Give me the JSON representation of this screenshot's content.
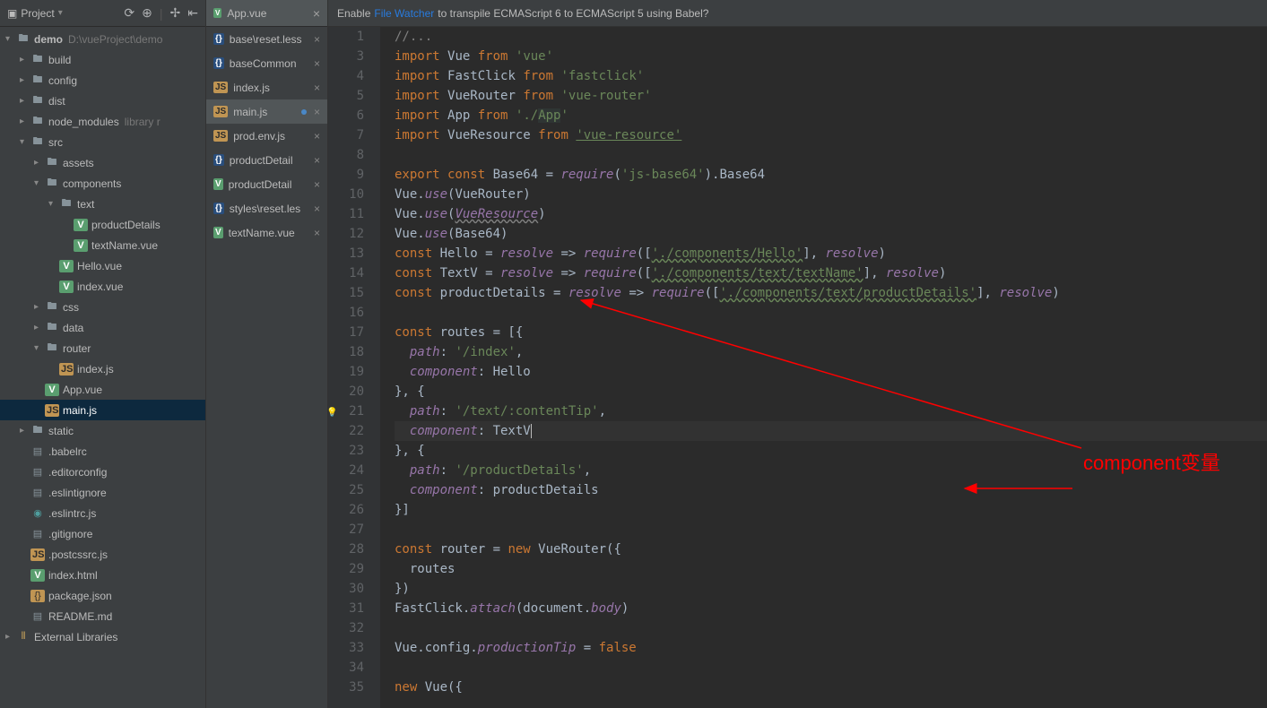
{
  "project": {
    "panel_title": "Project",
    "toolbar_icons": [
      "refresh-icon",
      "target-icon",
      "divider",
      "settings-icon",
      "collapse-icon"
    ],
    "tree": [
      {
        "depth": 0,
        "arrow": "▾",
        "icon": "folder",
        "label": "demo",
        "extra": "D:\\vueProject\\demo",
        "bold": true
      },
      {
        "depth": 1,
        "arrow": "▸",
        "icon": "folder",
        "label": "build"
      },
      {
        "depth": 1,
        "arrow": "▸",
        "icon": "folder",
        "label": "config"
      },
      {
        "depth": 1,
        "arrow": "▸",
        "icon": "folder",
        "label": "dist"
      },
      {
        "depth": 1,
        "arrow": "▸",
        "icon": "folder",
        "label": "node_modules",
        "extra": "library r"
      },
      {
        "depth": 1,
        "arrow": "▾",
        "icon": "folder",
        "label": "src"
      },
      {
        "depth": 2,
        "arrow": "▸",
        "icon": "folder",
        "label": "assets"
      },
      {
        "depth": 2,
        "arrow": "▾",
        "icon": "folder",
        "label": "components"
      },
      {
        "depth": 3,
        "arrow": "▾",
        "icon": "folder",
        "label": "text"
      },
      {
        "depth": 4,
        "arrow": "",
        "icon": "vue",
        "label": "productDetails"
      },
      {
        "depth": 4,
        "arrow": "",
        "icon": "vue",
        "label": "textName.vue"
      },
      {
        "depth": 3,
        "arrow": "",
        "icon": "vue",
        "label": "Hello.vue"
      },
      {
        "depth": 3,
        "arrow": "",
        "icon": "vue",
        "label": "index.vue"
      },
      {
        "depth": 2,
        "arrow": "▸",
        "icon": "folder",
        "label": "css"
      },
      {
        "depth": 2,
        "arrow": "▸",
        "icon": "folder",
        "label": "data"
      },
      {
        "depth": 2,
        "arrow": "▾",
        "icon": "folder",
        "label": "router"
      },
      {
        "depth": 3,
        "arrow": "",
        "icon": "js",
        "label": "index.js"
      },
      {
        "depth": 2,
        "arrow": "",
        "icon": "vue",
        "label": "App.vue"
      },
      {
        "depth": 2,
        "arrow": "",
        "icon": "js",
        "label": "main.js",
        "selected": true
      },
      {
        "depth": 1,
        "arrow": "▸",
        "icon": "folder",
        "label": "static"
      },
      {
        "depth": 1,
        "arrow": "",
        "icon": "file",
        "label": ".babelrc"
      },
      {
        "depth": 1,
        "arrow": "",
        "icon": "file",
        "label": ".editorconfig"
      },
      {
        "depth": 1,
        "arrow": "",
        "icon": "file",
        "label": ".eslintignore"
      },
      {
        "depth": 1,
        "arrow": "",
        "icon": "teal",
        "label": ".eslintrc.js"
      },
      {
        "depth": 1,
        "arrow": "",
        "icon": "file",
        "label": ".gitignore"
      },
      {
        "depth": 1,
        "arrow": "",
        "icon": "js",
        "label": ".postcssrc.js"
      },
      {
        "depth": 1,
        "arrow": "",
        "icon": "vue",
        "label": "index.html"
      },
      {
        "depth": 1,
        "arrow": "",
        "icon": "json",
        "label": "package.json"
      },
      {
        "depth": 1,
        "arrow": "",
        "icon": "file",
        "label": "README.md"
      },
      {
        "depth": 0,
        "arrow": "▸",
        "icon": "lib",
        "label": "External Libraries"
      }
    ]
  },
  "tabs": {
    "top": {
      "icon": "vue",
      "label": "App.vue"
    },
    "items": [
      {
        "icon": "less",
        "label": "base\\reset.less"
      },
      {
        "icon": "less",
        "label": "baseCommon"
      },
      {
        "icon": "js",
        "label": "index.js"
      },
      {
        "icon": "js",
        "label": "main.js",
        "active": true,
        "modified": true
      },
      {
        "icon": "js",
        "label": "prod.env.js"
      },
      {
        "icon": "less",
        "label": "productDetail"
      },
      {
        "icon": "vue",
        "label": "productDetail"
      },
      {
        "icon": "less",
        "label": "styles\\reset.les"
      },
      {
        "icon": "vue",
        "label": "textName.vue"
      }
    ]
  },
  "notification": {
    "prefix": "Enable",
    "link": "File Watcher",
    "suffix": "to transpile ECMAScript 6 to ECMAScript 5 using Babel?"
  },
  "editor": {
    "lines": [
      {
        "n": 1,
        "tokens": [
          {
            "t": "//...",
            "c": "comment"
          }
        ]
      },
      {
        "n": 3,
        "tokens": [
          {
            "t": "import ",
            "c": "kw"
          },
          {
            "t": "Vue ",
            "c": "id"
          },
          {
            "t": "from ",
            "c": "kw"
          },
          {
            "t": "'vue'",
            "c": "str"
          }
        ]
      },
      {
        "n": 4,
        "tokens": [
          {
            "t": "import ",
            "c": "kw"
          },
          {
            "t": "FastClick ",
            "c": "id"
          },
          {
            "t": "from ",
            "c": "kw"
          },
          {
            "t": "'fastclick'",
            "c": "str"
          }
        ]
      },
      {
        "n": 5,
        "tokens": [
          {
            "t": "import ",
            "c": "kw"
          },
          {
            "t": "VueRouter ",
            "c": "id"
          },
          {
            "t": "from ",
            "c": "kw"
          },
          {
            "t": "'vue-router'",
            "c": "str"
          }
        ]
      },
      {
        "n": 6,
        "tokens": [
          {
            "t": "import ",
            "c": "kw"
          },
          {
            "t": "App ",
            "c": "id"
          },
          {
            "t": "from ",
            "c": "kw"
          },
          {
            "t": "'./",
            "c": "str"
          },
          {
            "t": "App",
            "c": "str bg-hint"
          },
          {
            "t": "'",
            "c": "str"
          }
        ]
      },
      {
        "n": 7,
        "tokens": [
          {
            "t": "import ",
            "c": "kw"
          },
          {
            "t": "VueResource ",
            "c": "id"
          },
          {
            "t": "from ",
            "c": "kw"
          },
          {
            "t": "'vue-resource'",
            "c": "link-str underline-green"
          }
        ]
      },
      {
        "n": 8,
        "tokens": []
      },
      {
        "n": 9,
        "tokens": [
          {
            "t": "export const ",
            "c": "kw"
          },
          {
            "t": "Base64 = ",
            "c": "id"
          },
          {
            "t": "require",
            "c": "var"
          },
          {
            "t": "(",
            "c": "id"
          },
          {
            "t": "'js-base64'",
            "c": "str"
          },
          {
            "t": ").Base64",
            "c": "id"
          }
        ]
      },
      {
        "n": 10,
        "tokens": [
          {
            "t": "Vue.",
            "c": "id"
          },
          {
            "t": "use",
            "c": "var"
          },
          {
            "t": "(VueRouter)",
            "c": "id"
          }
        ]
      },
      {
        "n": 11,
        "tokens": [
          {
            "t": "Vue.",
            "c": "id"
          },
          {
            "t": "use",
            "c": "var"
          },
          {
            "t": "(",
            "c": "id"
          },
          {
            "t": "VueResource",
            "c": "var underline-gray"
          },
          {
            "t": ")",
            "c": "id"
          }
        ]
      },
      {
        "n": 12,
        "tokens": [
          {
            "t": "Vue.",
            "c": "id"
          },
          {
            "t": "use",
            "c": "var"
          },
          {
            "t": "(Base64)",
            "c": "id"
          }
        ]
      },
      {
        "n": 13,
        "tokens": [
          {
            "t": "const ",
            "c": "kw"
          },
          {
            "t": "Hello = ",
            "c": "id"
          },
          {
            "t": "resolve",
            "c": "var"
          },
          {
            "t": " => ",
            "c": "id"
          },
          {
            "t": "require",
            "c": "var"
          },
          {
            "t": "([",
            "c": "id"
          },
          {
            "t": "'./components/Hello'",
            "c": "str underline-green"
          },
          {
            "t": "], ",
            "c": "id"
          },
          {
            "t": "resolve",
            "c": "var"
          },
          {
            "t": ")",
            "c": "id"
          }
        ]
      },
      {
        "n": 14,
        "tokens": [
          {
            "t": "const ",
            "c": "kw"
          },
          {
            "t": "TextV = ",
            "c": "id"
          },
          {
            "t": "resolve",
            "c": "var"
          },
          {
            "t": " => ",
            "c": "id"
          },
          {
            "t": "require",
            "c": "var"
          },
          {
            "t": "([",
            "c": "id"
          },
          {
            "t": "'./components/text/textName'",
            "c": "str underline-green"
          },
          {
            "t": "], ",
            "c": "id"
          },
          {
            "t": "resolve",
            "c": "var"
          },
          {
            "t": ")",
            "c": "id"
          }
        ]
      },
      {
        "n": 15,
        "tokens": [
          {
            "t": "const ",
            "c": "kw"
          },
          {
            "t": "productDetails = ",
            "c": "id"
          },
          {
            "t": "resolve",
            "c": "var"
          },
          {
            "t": " => ",
            "c": "id"
          },
          {
            "t": "require",
            "c": "var"
          },
          {
            "t": "([",
            "c": "id"
          },
          {
            "t": "'./components/text/productDetails'",
            "c": "str underline-green"
          },
          {
            "t": "], ",
            "c": "id"
          },
          {
            "t": "resolve",
            "c": "var"
          },
          {
            "t": ")",
            "c": "id"
          }
        ]
      },
      {
        "n": 16,
        "tokens": []
      },
      {
        "n": 17,
        "tokens": [
          {
            "t": "const ",
            "c": "kw"
          },
          {
            "t": "routes = [{",
            "c": "id"
          }
        ]
      },
      {
        "n": 18,
        "tokens": [
          {
            "t": "  ",
            "c": "id"
          },
          {
            "t": "path",
            "c": "var"
          },
          {
            "t": ": ",
            "c": "id"
          },
          {
            "t": "'/index'",
            "c": "str"
          },
          {
            "t": ",",
            "c": "id"
          }
        ]
      },
      {
        "n": 19,
        "tokens": [
          {
            "t": "  ",
            "c": "id"
          },
          {
            "t": "component",
            "c": "var"
          },
          {
            "t": ": Hello",
            "c": "id"
          }
        ]
      },
      {
        "n": 20,
        "tokens": [
          {
            "t": "}, {",
            "c": "id"
          }
        ]
      },
      {
        "n": 21,
        "tokens": [
          {
            "t": "  ",
            "c": "id"
          },
          {
            "t": "path",
            "c": "var"
          },
          {
            "t": ": ",
            "c": "id"
          },
          {
            "t": "'/text/:contentTip'",
            "c": "str"
          },
          {
            "t": ",",
            "c": "id"
          }
        ]
      },
      {
        "n": 22,
        "current": true,
        "tokens": [
          {
            "t": "  ",
            "c": "id"
          },
          {
            "t": "component",
            "c": "var"
          },
          {
            "t": ": TextV",
            "c": "id"
          }
        ]
      },
      {
        "n": 23,
        "tokens": [
          {
            "t": "}, {",
            "c": "id"
          }
        ]
      },
      {
        "n": 24,
        "tokens": [
          {
            "t": "  ",
            "c": "id"
          },
          {
            "t": "path",
            "c": "var"
          },
          {
            "t": ": ",
            "c": "id"
          },
          {
            "t": "'/productDetails'",
            "c": "str"
          },
          {
            "t": ",",
            "c": "id"
          }
        ]
      },
      {
        "n": 25,
        "tokens": [
          {
            "t": "  ",
            "c": "id"
          },
          {
            "t": "component",
            "c": "var"
          },
          {
            "t": ": productDetails",
            "c": "id"
          }
        ]
      },
      {
        "n": 26,
        "tokens": [
          {
            "t": "}]",
            "c": "id"
          }
        ]
      },
      {
        "n": 27,
        "tokens": []
      },
      {
        "n": 28,
        "tokens": [
          {
            "t": "const ",
            "c": "kw"
          },
          {
            "t": "router = ",
            "c": "id"
          },
          {
            "t": "new ",
            "c": "kw"
          },
          {
            "t": "VueRouter({",
            "c": "id"
          }
        ]
      },
      {
        "n": 29,
        "tokens": [
          {
            "t": "  routes",
            "c": "id"
          }
        ]
      },
      {
        "n": 30,
        "tokens": [
          {
            "t": "})",
            "c": "id"
          }
        ]
      },
      {
        "n": 31,
        "tokens": [
          {
            "t": "FastClick.",
            "c": "id"
          },
          {
            "t": "attach",
            "c": "var"
          },
          {
            "t": "(document.",
            "c": "id"
          },
          {
            "t": "body",
            "c": "var"
          },
          {
            "t": ")",
            "c": "id"
          }
        ]
      },
      {
        "n": 32,
        "tokens": []
      },
      {
        "n": 33,
        "tokens": [
          {
            "t": "Vue.config.",
            "c": "id"
          },
          {
            "t": "productionTip",
            "c": "var"
          },
          {
            "t": " = ",
            "c": "id"
          },
          {
            "t": "false",
            "c": "kw"
          }
        ]
      },
      {
        "n": 34,
        "tokens": []
      },
      {
        "n": 35,
        "tokens": [
          {
            "t": "new ",
            "c": "kw"
          },
          {
            "t": "Vue({",
            "c": "id"
          }
        ]
      }
    ],
    "bulb_line": 21
  },
  "annotation_text": "component变量"
}
